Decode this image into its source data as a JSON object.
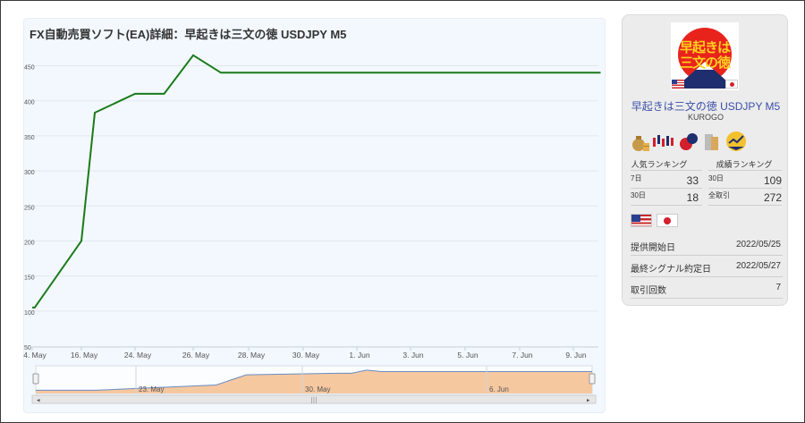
{
  "chart": {
    "title": "FX自動売買ソフト(EA)詳細：早起きは三文の徳 USDJPY M5"
  },
  "chart_data": {
    "type": "line",
    "ylim": [
      50,
      480
    ],
    "yticks": [
      50,
      100,
      150,
      200,
      250,
      300,
      350,
      400,
      450
    ],
    "xticks": [
      "4. May",
      "16. May",
      "24. May",
      "26. May",
      "28. May",
      "30. May",
      "1. Jun",
      "3. Jun",
      "5. Jun",
      "7. Jun",
      "9. Jun"
    ],
    "series": [
      {
        "color": "#1a7a1a",
        "points": [
          [
            "4. May",
            105
          ],
          [
            "4. May+",
            105
          ],
          [
            "16. May",
            200
          ],
          [
            "18. May",
            383
          ],
          [
            "24. May",
            410
          ],
          [
            "25. May",
            410
          ],
          [
            "26. May",
            465
          ],
          [
            "27. May",
            440
          ],
          [
            "10. Jun",
            440
          ]
        ]
      }
    ],
    "grid": true,
    "navigator": {
      "labels": [
        "23. May",
        "30. May",
        "6. Jun"
      ],
      "fill": "#f5c8a0",
      "line": "#6a8bc4"
    }
  },
  "sidebar": {
    "strategy_name": "早起きは三文の徳 USDJPY M5",
    "developer": "KUROGO",
    "logo_text": "早起きは三文の徳",
    "popular_ranking_label": "人気ランキング",
    "performance_ranking_label": "成績ランキング",
    "popular": [
      {
        "period": "7日",
        "rank": "33"
      },
      {
        "period": "30日",
        "rank": "18"
      }
    ],
    "performance": [
      {
        "period": "30日",
        "rank": "109"
      },
      {
        "period": "全取引",
        "rank": "272"
      }
    ],
    "info": [
      {
        "label": "提供開始日",
        "value": "2022/05/25"
      },
      {
        "label": "最終シグナル約定日",
        "value": "2022/05/27"
      },
      {
        "label": "取引回数",
        "value": "7"
      }
    ]
  },
  "colors": {
    "line": "#1a7a1a",
    "navigator_fill": "#f5c8a0",
    "title_link": "#3a4fa8"
  }
}
